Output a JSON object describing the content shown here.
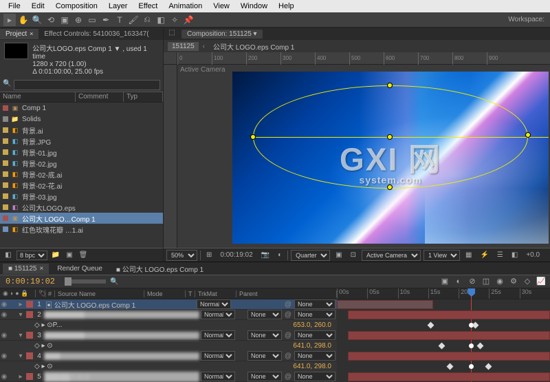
{
  "menu": {
    "items": [
      "File",
      "Edit",
      "Composition",
      "Layer",
      "Effect",
      "Animation",
      "View",
      "Window",
      "Help"
    ]
  },
  "workspace": {
    "label": "Workspace:"
  },
  "project_panel": {
    "tab_project": "Project",
    "tab_effect_controls": "Effect Controls: 5410036_163347(",
    "comp_title": "公司大LOGO.eps Comp 1 ▼ , used 1 time",
    "comp_meta1": "1280 x 720 (1.00)",
    "comp_meta2": "Δ 0:01:00:00, 25.00 fps",
    "search_placeholder": "",
    "cols": {
      "name": "Name",
      "comment": "Comment",
      "type": "Typ"
    },
    "items": [
      {
        "name": "Comp 1",
        "type": "comp",
        "color": "c1"
      },
      {
        "name": "Solids",
        "type": "folder",
        "color": "folder"
      },
      {
        "name": "背景.ai",
        "type": "ai",
        "color": "c2"
      },
      {
        "name": "背景.JPG",
        "type": "jpg",
        "color": "c2"
      },
      {
        "name": "背景-01.jpg",
        "type": "jpg",
        "color": "c2"
      },
      {
        "name": "背景-02.jpg",
        "type": "jpg",
        "color": "c2"
      },
      {
        "name": "背景-02-底.ai",
        "type": "ai",
        "color": "c2"
      },
      {
        "name": "背景-02-花.ai",
        "type": "ai",
        "color": "c2"
      },
      {
        "name": "背景-03.jpg",
        "type": "jpg",
        "color": "c2"
      },
      {
        "name": "公司大LOGO.eps",
        "type": "eps",
        "color": "c2"
      },
      {
        "name": "公司大 LOGO…Comp 1",
        "type": "comp",
        "color": "c1",
        "selected": true
      },
      {
        "name": "红色玫瑰花瓣 …1.ai",
        "type": "ai",
        "color": "c3"
      }
    ],
    "footer_bpc": "8 bpc"
  },
  "comp_panel": {
    "tab_label": "Composition: 151125",
    "crumb1": "151125",
    "crumb2": "公司大 LOGO.eps Comp 1",
    "camera": "Active Camera",
    "ruler_ticks": [
      "0",
      "100",
      "200",
      "300",
      "400",
      "500",
      "600",
      "700",
      "800",
      "900"
    ],
    "footer": {
      "zoom": "50%",
      "time": "0:00:19:02",
      "res": "Quarter",
      "camera": "Active Camera",
      "views": "1 View",
      "zero": "+0.0"
    }
  },
  "watermark": {
    "main": "GXI 网",
    "sub": "system.com"
  },
  "timeline": {
    "tabs": [
      {
        "label": "151125",
        "active": true
      },
      {
        "label": "Render Queue",
        "active": false
      },
      {
        "label": "公司大 LOGO.eps Comp 1",
        "active": false
      }
    ],
    "timecode": "0:00:19:02",
    "header": {
      "source": "Source Name",
      "mode": "Mode",
      "t": "T",
      "trkmat": "TrkMat",
      "parent": "Parent"
    },
    "mode_normal": "Normal",
    "mat_none": "None",
    "parent_none": "None",
    "time_ticks": [
      "00s",
      "05s",
      "10s",
      "15s",
      "20s",
      "25s",
      "30s"
    ],
    "layers": [
      {
        "num": "1",
        "name": "公司大 LOGO.eps Comp 1",
        "color": "#a85050"
      },
      {
        "num": "2",
        "name": "",
        "color": "#a85050"
      },
      {
        "num": "3",
        "name": "",
        "color": "#a85050"
      },
      {
        "num": "4",
        "name": "",
        "color": "#a85050"
      },
      {
        "num": "5",
        "name": "",
        "color": "#a85050"
      }
    ],
    "props": [
      {
        "label": "P...",
        "value": "653.0, 260.0"
      },
      {
        "label": "",
        "value": "641.0, 298.0"
      },
      {
        "label": "",
        "value": "641.0, 298.0"
      }
    ]
  }
}
